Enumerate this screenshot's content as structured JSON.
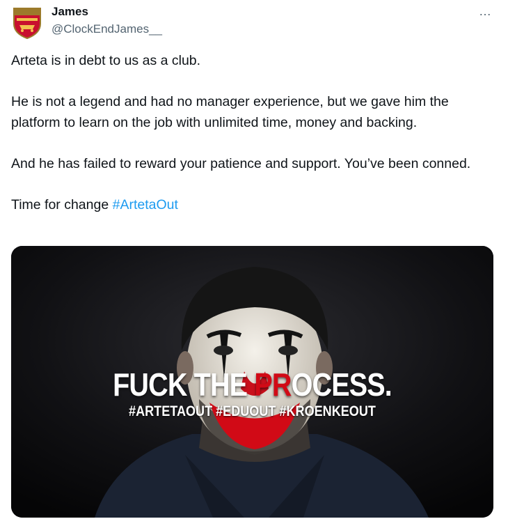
{
  "tweet": {
    "author": {
      "display_name": "James",
      "handle": "@ClockEndJames__",
      "avatar_icon": "arsenal-crest-icon"
    },
    "more_icon": "…",
    "text": {
      "p1": "Arteta is in debt to us as a club.",
      "p2": "He is not a legend and had no manager experience, but we gave him the platform to learn on the job with unlimited time, money and backing.",
      "p3": "And he has failed to reward your patience and support. You’ve been conned.",
      "p4_prefix": "Time for change ",
      "p4_hashtag": "#ArtetaOut"
    },
    "media": {
      "headline_white_1": "FUCK THE ",
      "headline_red": "PR",
      "headline_white_2": "OCESS.",
      "tags": "#ARTETAOUT #EDUOUT #KROENKEOUT",
      "colors": {
        "accent_red": "#d10a16",
        "hashtag_blue": "#1d9bf0"
      }
    }
  }
}
